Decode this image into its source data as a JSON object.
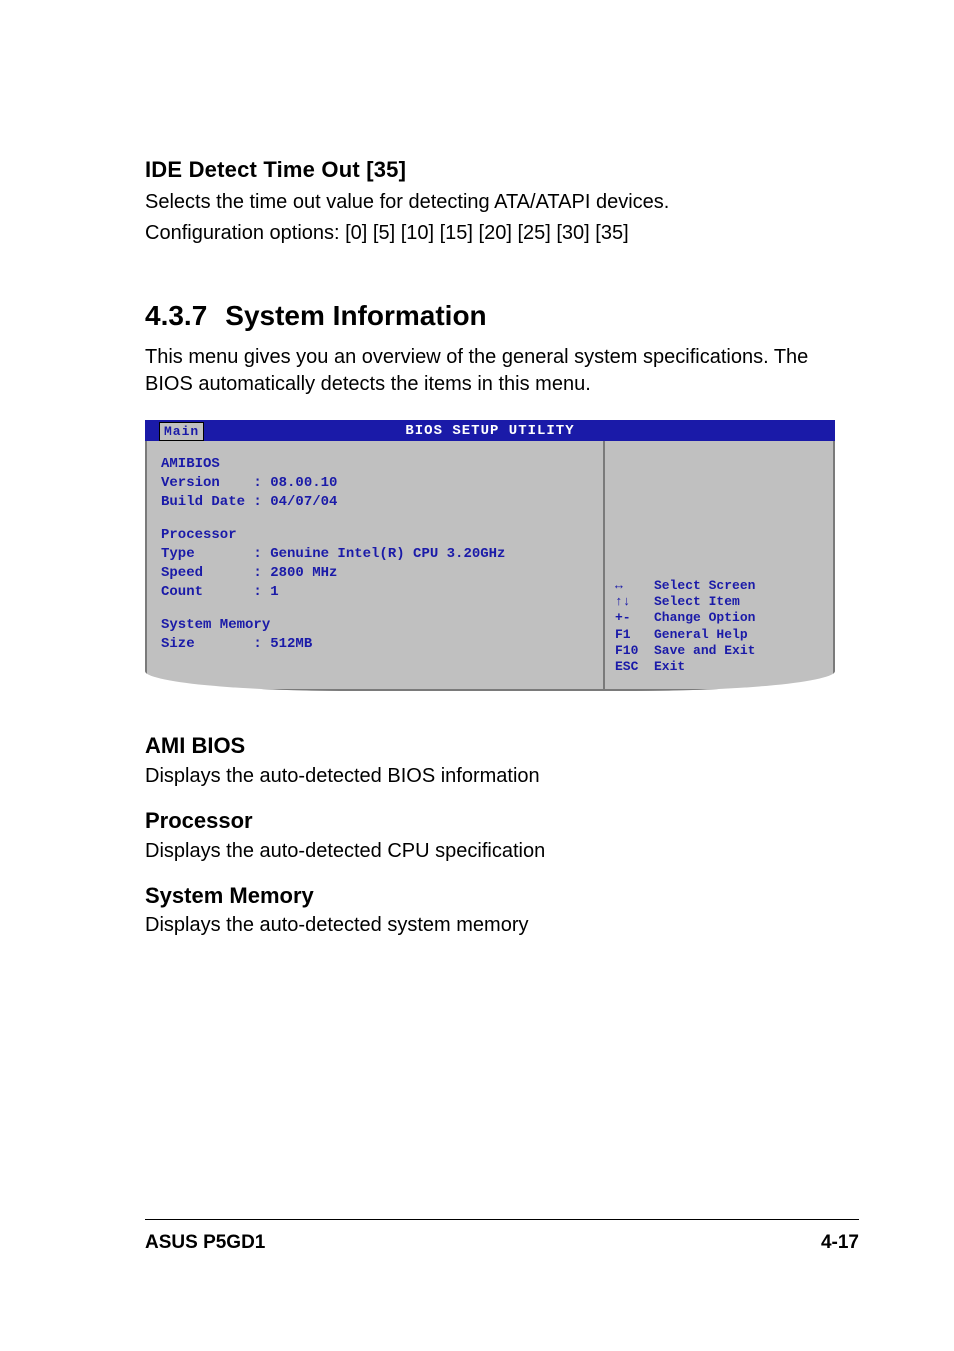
{
  "ide": {
    "heading": "IDE Detect Time Out [35]",
    "line1": "Selects the time out value for detecting ATA/ATAPI devices.",
    "line2": "Configuration options: [0] [5] [10] [15] [20] [25] [30] [35]"
  },
  "section": {
    "number": "4.3.7",
    "title": "System Information",
    "desc": "This menu gives you an overview of the general system specifications. The BIOS automatically detects the items in this menu."
  },
  "bios": {
    "title": "BIOS SETUP UTILITY",
    "tab": "Main",
    "left": {
      "amibios": "AMIBIOS",
      "version": "Version    : 08.00.10",
      "builddate": "Build Date : 04/07/04",
      "processor": "Processor",
      "type": "Type       : Genuine Intel(R) CPU 3.20GHz",
      "speed": "Speed      : 2800 MHz",
      "count": "Count      : 1",
      "sysmem": "System Memory",
      "size": "Size       : 512MB"
    },
    "nav": {
      "r1": "↔    Select Screen",
      "r2": "↑↓   Select Item",
      "r3": "+-   Change Option",
      "r4": "F1   General Help",
      "r5": "F10  Save and Exit",
      "r6": "ESC  Exit"
    }
  },
  "ami": {
    "heading": "AMI BIOS",
    "desc": "Displays the auto-detected BIOS information"
  },
  "proc": {
    "heading": "Processor",
    "desc": "Displays the auto-detected CPU specification"
  },
  "mem": {
    "heading": "System Memory",
    "desc": "Displays the auto-detected system memory"
  },
  "footer": {
    "left": "ASUS P5GD1",
    "right": "4-17"
  }
}
